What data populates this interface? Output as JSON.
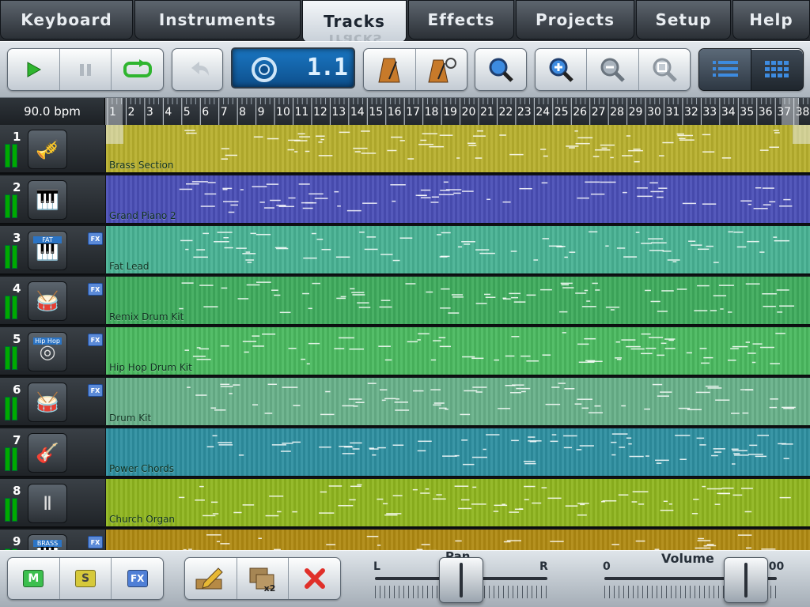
{
  "tabs": [
    {
      "label": "Keyboard",
      "active": false
    },
    {
      "label": "Instruments",
      "active": false
    },
    {
      "label": "Tracks",
      "active": true
    },
    {
      "label": "Effects",
      "active": false
    },
    {
      "label": "Projects",
      "active": false
    },
    {
      "label": "Setup",
      "active": false
    },
    {
      "label": "Help",
      "active": false
    }
  ],
  "toolbar": {
    "transport": [
      "play-icon",
      "pause-icon",
      "loop-icon"
    ],
    "undo_icon": "undo-icon",
    "position_display": "1.1",
    "metronome_icons": [
      "metronome-icon",
      "metronome-settings-icon"
    ],
    "search_icon": "search-icon",
    "zoom_icons": [
      "zoom-in-icon",
      "zoom-out-icon",
      "zoom-fit-icon"
    ],
    "view_icons": [
      "list-view-icon",
      "grid-view-icon"
    ]
  },
  "tempo": "90.0 bpm",
  "ruler": {
    "bars": [
      "1",
      "2",
      "3",
      "4",
      "5",
      "6",
      "7",
      "8",
      "9",
      "10",
      "11",
      "12",
      "13",
      "14",
      "15",
      "16",
      "17",
      "18",
      "19",
      "20",
      "21",
      "22",
      "23",
      "24",
      "25",
      "26",
      "27",
      "28",
      "29",
      "30",
      "31",
      "32",
      "33",
      "34",
      "35",
      "36",
      "37",
      "38"
    ]
  },
  "tracks": [
    {
      "number": "1",
      "name": "Brass Section",
      "instrument_icon": "french-horn-icon",
      "fx": false,
      "color": "#b8b02e"
    },
    {
      "number": "2",
      "name": "Grand Piano 2",
      "instrument_icon": "grand-piano-icon",
      "fx": false,
      "color": "#4a4fb7"
    },
    {
      "number": "3",
      "name": "Fat Lead",
      "instrument_icon": "synth-keyboard-icon",
      "fx": true,
      "icon_label": "FAT",
      "color": "#48b394"
    },
    {
      "number": "4",
      "name": "Remix Drum Kit",
      "instrument_icon": "drum-kit-icon",
      "fx": true,
      "color": "#3fac5d"
    },
    {
      "number": "5",
      "name": "Hip Hop Drum Kit",
      "instrument_icon": "turntable-icon",
      "fx": true,
      "icon_label": "Hip Hop",
      "color": "#4aba60"
    },
    {
      "number": "6",
      "name": "Drum Kit",
      "instrument_icon": "acoustic-drums-icon",
      "fx": true,
      "color": "#68b18a"
    },
    {
      "number": "7",
      "name": "Power Chords",
      "instrument_icon": "electric-guitar-icon",
      "fx": false,
      "color": "#2e8fa0"
    },
    {
      "number": "8",
      "name": "Church Organ",
      "instrument_icon": "pipe-organ-icon",
      "fx": false,
      "color": "#8fb61f"
    },
    {
      "number": "9",
      "name": "",
      "instrument_icon": "brass-keyboard-icon",
      "fx": true,
      "icon_label": "BRASS",
      "color": "#b08a12"
    }
  ],
  "fx_label": "FX",
  "bottom": {
    "mute_label": "M",
    "solo_label": "S",
    "fx_label": "FX",
    "edit_icon": "pencil-icon",
    "duplicate_icon": "duplicate-x2-icon",
    "duplicate_label": "x2",
    "delete_icon": "delete-x-icon",
    "pan": {
      "label": "Pan",
      "left": "L",
      "right": "R",
      "value": 0.5
    },
    "volume": {
      "label": "Volume",
      "min": "0",
      "max": "100",
      "value": 0.82
    }
  }
}
